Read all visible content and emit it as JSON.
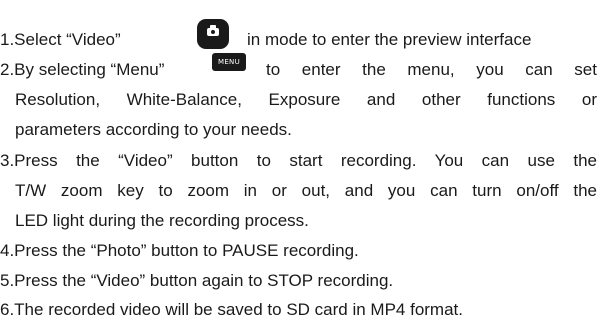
{
  "steps": [
    {
      "before_icon": "1.Select “Video”",
      "after_icon": "in mode to enter the preview interface",
      "icon": "video-mode-icon"
    },
    {
      "before_icon": "2.By selecting “Menu”",
      "icon_label": "MENU",
      "after_icon": "to enter the menu, you can set",
      "continuation": [
        "Resolution, White-Balance, Exposure and other functions or",
        "parameters according to your needs."
      ]
    },
    {
      "lines": [
        "3.Press the “Video” button to start recording. You can use the",
        "T/W zoom key to zoom in or out, and you can turn on/off the",
        "LED light during the recording process."
      ]
    },
    {
      "lines": [
        "4.Press the “Photo” button to PAUSE recording."
      ]
    },
    {
      "lines": [
        "5.Press the “Video” button again to STOP recording."
      ]
    },
    {
      "lines": [
        "6.The recorded video will be saved to SD card in MP4 format."
      ]
    }
  ]
}
